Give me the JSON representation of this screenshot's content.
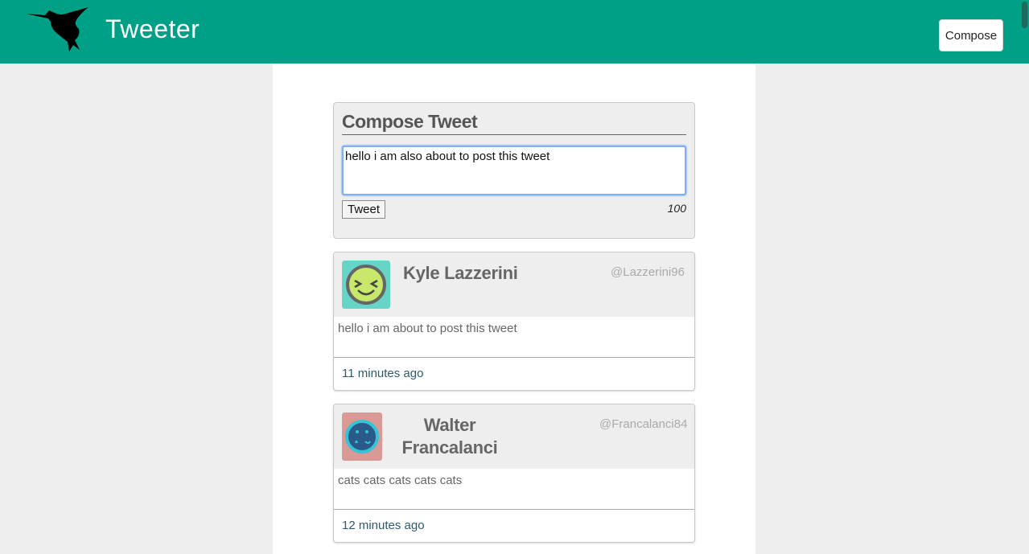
{
  "nav": {
    "brand": "Tweeter",
    "compose_label": "Compose",
    "logo_icon": "hummingbird-icon"
  },
  "new_tweet": {
    "heading": "Compose Tweet",
    "input_value": "hello i am also about to post this tweet",
    "submit_label": "Tweet",
    "counter": "100"
  },
  "tweets": [
    {
      "name": "Kyle Lazzerini",
      "handle": "@Lazzerini96",
      "content": "hello i am about to post this tweet",
      "time": "11 minutes ago",
      "avatar_icon": "laughing-face-avatar-icon",
      "avatar_bg": "#67d4c8"
    },
    {
      "name": "Walter Francalanci",
      "handle": "@Francalanci84",
      "content": "cats cats cats cats cats",
      "time": "12 minutes ago",
      "avatar_icon": "crying-face-avatar-icon",
      "avatar_bg": "#d99a95"
    }
  ],
  "colors": {
    "nav_bg": "#00a087",
    "page_bg": "#eeeeee",
    "name_text": "#666666",
    "handle_text": "#aaaaaa",
    "time_text": "#2e5a6a"
  }
}
